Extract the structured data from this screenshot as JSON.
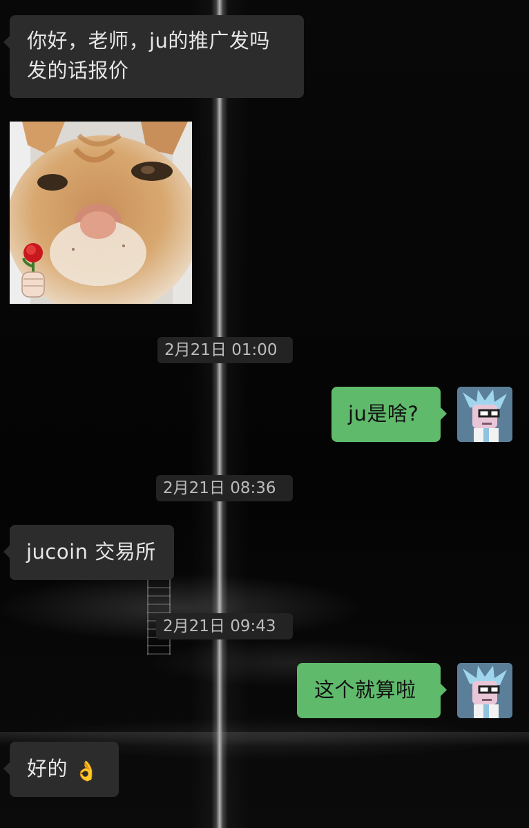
{
  "chat": {
    "messages": [
      {
        "side": "in",
        "line1": "你好，老师，ju的推广发吗",
        "line2": "发的话报价"
      },
      {
        "side": "in",
        "type": "sticker",
        "sticker_name": "cat-holding-rose-sticker"
      },
      {
        "type": "timestamp",
        "text": "2月21日 01:00"
      },
      {
        "side": "out",
        "text": "ju是啥?"
      },
      {
        "type": "timestamp",
        "text": "2月21日 08:36"
      },
      {
        "side": "in",
        "text": "jucoin 交易所"
      },
      {
        "type": "timestamp",
        "text": "2月21日 09:43"
      },
      {
        "side": "out",
        "text": "这个就算啦"
      },
      {
        "side": "in",
        "text": "好的",
        "emoji": "👌",
        "emoji_name": "ok-hand-emoji"
      }
    ]
  },
  "avatar": {
    "icon": "cartoon-scientist-avatar-icon"
  },
  "colors": {
    "incoming_bubble": "#2c2c2c",
    "outgoing_bubble": "#5fba6b",
    "timestamp_pill": "#232323",
    "background": "#050505"
  }
}
